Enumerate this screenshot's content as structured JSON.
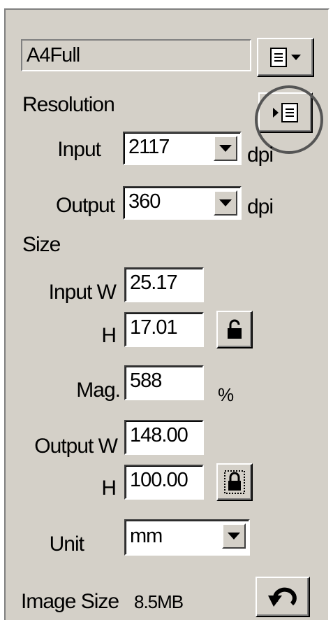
{
  "preset": {
    "value": "A4Full",
    "menu_icon": "document-list-icon"
  },
  "resolution": {
    "heading": "Resolution",
    "menu_icon": "resolution-menu-icon",
    "input_label": "Input",
    "input_value": "2117",
    "input_unit": "dpi",
    "output_label": "Output",
    "output_value": "360",
    "output_unit": "dpi"
  },
  "size": {
    "heading": "Size",
    "input_w_label": "Input W",
    "input_w_value": "25.17",
    "input_h_label": "H",
    "input_h_value": "17.01",
    "input_lock_icon": "padlock-open-icon",
    "mag_label": "Mag.",
    "mag_value": "588",
    "mag_unit": "%",
    "output_w_label": "Output W",
    "output_w_value": "148.00",
    "output_h_label": "H",
    "output_h_value": "100.00",
    "output_lock_icon": "padlock-closed-icon",
    "unit_label": "Unit",
    "unit_value": "mm"
  },
  "footer": {
    "image_size_label": "Image Size",
    "image_size_value": "8.5MB",
    "reset_icon": "undo-arrow-icon"
  }
}
